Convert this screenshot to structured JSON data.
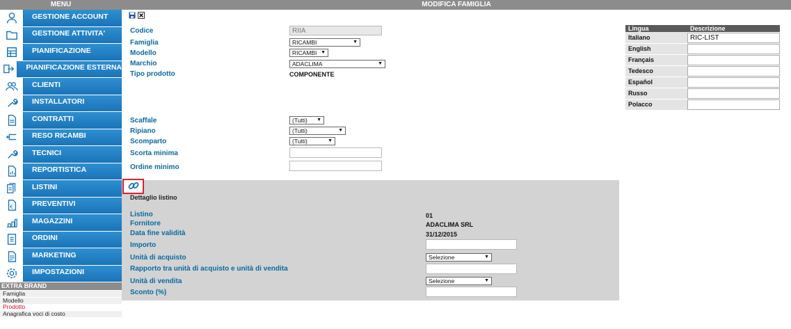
{
  "topbar": {
    "menu_title": "MENU",
    "page_title": "MODIFICA FAMIGLIA"
  },
  "sidebar": {
    "items": [
      {
        "label": "GESTIONE ACCOUNT",
        "icon": "account-icon"
      },
      {
        "label": "GESTIONE ATTIVITA'",
        "icon": "folder-icon"
      },
      {
        "label": "PIANIFICAZIONE",
        "icon": "planning-icon"
      },
      {
        "label": "PIANIFICAZIONE ESTERNA",
        "icon": "external-planning-icon"
      },
      {
        "label": "CLIENTI",
        "icon": "clients-icon"
      },
      {
        "label": "INSTALLATORI",
        "icon": "wrench-icon"
      },
      {
        "label": "CONTRATTI",
        "icon": "document-icon"
      },
      {
        "label": "RESO RICAMBI",
        "icon": "return-icon"
      },
      {
        "label": "TECNICI",
        "icon": "wrench-icon"
      },
      {
        "label": "REPORTISTICA",
        "icon": "report-icon"
      },
      {
        "label": "LISTINI",
        "icon": "price-list-icon"
      },
      {
        "label": "PREVENTIVI",
        "icon": "quote-icon"
      },
      {
        "label": "MAGAZZINI",
        "icon": "warehouse-icon"
      },
      {
        "label": "ORDINI",
        "icon": "orders-icon"
      },
      {
        "label": "MARKETING",
        "icon": "marketing-icon"
      },
      {
        "label": "IMPOSTAZIONI",
        "icon": "gear-icon"
      }
    ],
    "extra_brand": {
      "title": "EXTRA BRAND",
      "items": [
        "Famiglia",
        "Modello",
        "Prodotto",
        "Anagrafica voci di costo"
      ],
      "active": "Prodotto"
    }
  },
  "form": {
    "codice": {
      "label": "Codice",
      "value": "RIIA"
    },
    "famiglia": {
      "label": "Famiglia",
      "value": "RICAMBI"
    },
    "modello": {
      "label": "Modello",
      "value": "RICAMBI"
    },
    "marchio": {
      "label": "Marchio",
      "value": "ADACLIMA"
    },
    "tipo_prodotto": {
      "label": "Tipo prodotto",
      "value": "COMPONENTE"
    },
    "scaffale": {
      "label": "Scaffale",
      "value": "(Tutti)"
    },
    "ripiano": {
      "label": "Ripiano",
      "value": "(Tutti)"
    },
    "scomparto": {
      "label": "Scomparto",
      "value": "(Tutti)"
    },
    "scorta_minima": {
      "label": "Scorta minima",
      "value": ""
    },
    "ordine_minimo": {
      "label": "Ordine minimo",
      "value": ""
    }
  },
  "detail": {
    "title": "Dettaglio listino",
    "listino": {
      "label": "Listino",
      "value": "01"
    },
    "fornitore": {
      "label": "Fornitore",
      "value": "ADACLIMA SRL"
    },
    "data_fine": {
      "label": "Data fine validità",
      "value": "31/12/2015"
    },
    "importo": {
      "label": "Importo",
      "value": ""
    },
    "unita_acquisto": {
      "label": "Unità di acquisto",
      "value": "Selezione"
    },
    "rapporto": {
      "label": "Rapporto tra unità di acquisto e unità di vendita",
      "value": ""
    },
    "unita_vendita": {
      "label": "Unità di vendita",
      "value": "Selezione"
    },
    "sconto": {
      "label": "Sconto (%)",
      "value": ""
    }
  },
  "languages": {
    "headers": [
      "Lingua",
      "Descrizione"
    ],
    "rows": [
      {
        "name": "Italiano",
        "value": "RIC-LIST"
      },
      {
        "name": "English",
        "value": ""
      },
      {
        "name": "Français",
        "value": ""
      },
      {
        "name": "Tedesco",
        "value": ""
      },
      {
        "name": "Español",
        "value": ""
      },
      {
        "name": "Russo",
        "value": ""
      },
      {
        "name": "Polacco",
        "value": ""
      }
    ]
  },
  "colors": {
    "nav_blue": "#1a74b8",
    "label_blue": "#0a6aa0",
    "header_gray": "#8c8c8c",
    "highlight_red": "#e0202a"
  }
}
